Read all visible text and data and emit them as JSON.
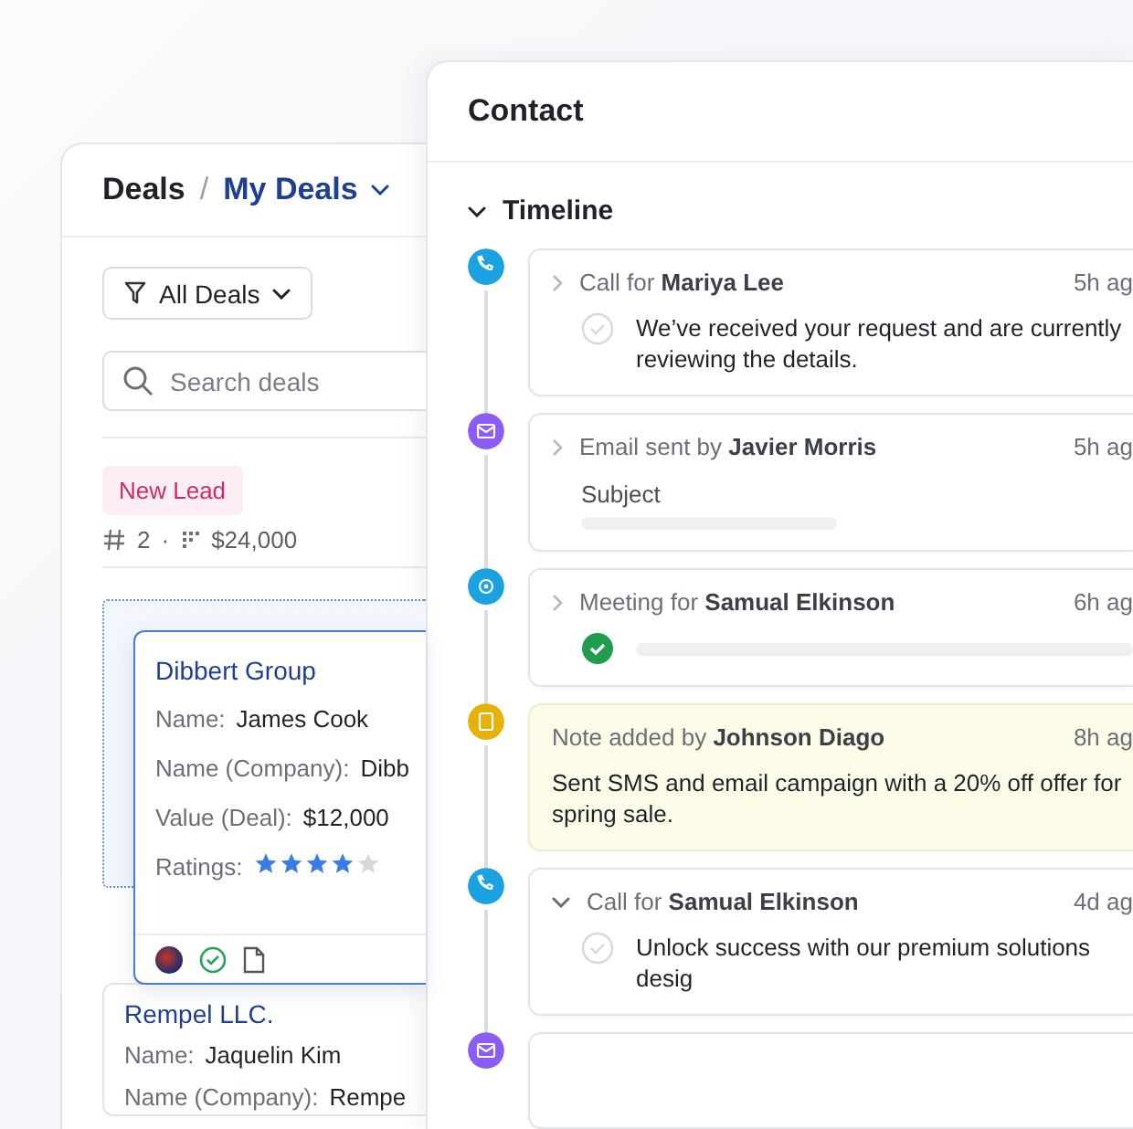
{
  "deals": {
    "title": "Deals",
    "separator": "/",
    "view": "My Deals",
    "filter": "All Deals",
    "search": {
      "placeholder": "Search deals"
    },
    "stage": {
      "label": "New Lead",
      "count": "2",
      "separator": "·",
      "amount": "$24,000"
    },
    "cards": [
      {
        "title": "Dibbert Group",
        "dragging": true,
        "fields": [
          {
            "label": "Name:",
            "value": "James Cook"
          },
          {
            "label": "Name (Company):",
            "value": "Dibb"
          },
          {
            "label": "Value (Deal):",
            "value": "$12,000"
          }
        ],
        "rating_label": "Ratings:",
        "stars": 4
      },
      {
        "title": "Rempel LLC.",
        "dragging": false,
        "fields": [
          {
            "label": "Name:",
            "value": "Jaquelin Kim"
          },
          {
            "label": "Name (Company):",
            "value": "Rempe"
          }
        ]
      }
    ]
  },
  "contact": {
    "title": "Contact",
    "section": "Timeline",
    "section_expanded": true,
    "timeline": [
      {
        "kind": "call",
        "color": "#1ba3e1",
        "expanded": false,
        "title": "Call for **Mariya Lee**",
        "time": "5h ag",
        "text": "We’ve received your request and are currently reviewing the details.",
        "done": false
      },
      {
        "kind": "email",
        "color": "#8b5cf6",
        "expanded": false,
        "title": "Email sent by **Javier Morris**",
        "time": "5h ag",
        "subject_label": "Subject"
      },
      {
        "kind": "meeting",
        "color": "#1ba3e1",
        "expanded": false,
        "title": "Meeting for **Samual Elkinson**",
        "time": "6h ag",
        "done": true
      },
      {
        "kind": "note",
        "color": "#e8b10a",
        "title": "Note added by **Johnson Diago**",
        "time": "8h ag",
        "text": "Sent SMS and email campaign with a 20% off offer for spring sale."
      },
      {
        "kind": "call",
        "color": "#1ba3e1",
        "expanded": true,
        "title": "Call for **Samual Elkinson**",
        "time": "4d ag",
        "text": "Unlock success with our premium solutions desig",
        "done": false
      },
      {
        "kind": "email",
        "color": "#8b5cf6"
      }
    ]
  }
}
